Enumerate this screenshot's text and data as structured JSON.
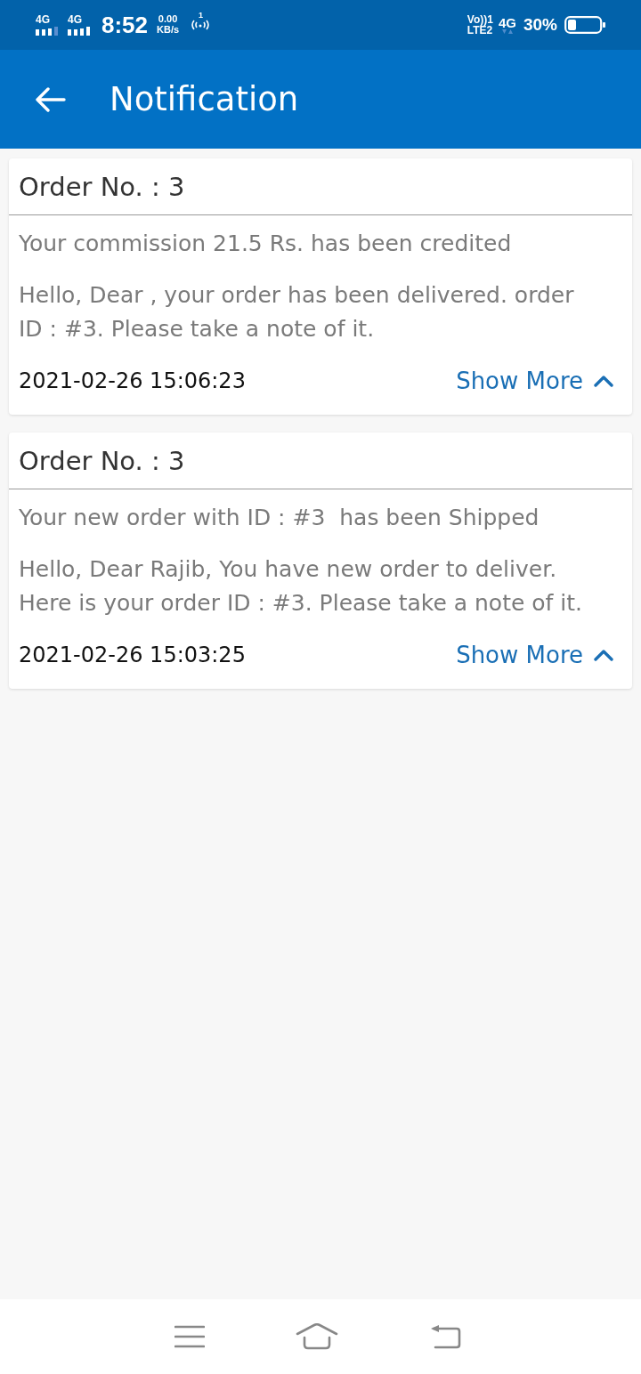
{
  "status_bar": {
    "sim1_network": "4G",
    "sim2_network": "4G",
    "time": "8:52",
    "speed_value": "0.00",
    "speed_unit": "KB/s",
    "hotspot_count": "1",
    "volte": "Vo))1",
    "volte_line": "LTE2",
    "data_network": "4G",
    "battery": "30%"
  },
  "app_bar": {
    "title": "Notification"
  },
  "notifications": [
    {
      "title": "Order No. : 3",
      "subtitle": "Your commission 21.5 Rs. has been credited",
      "message": "Hello, Dear , your order has been delivered. order ID : #3. Please take a note of it.",
      "time": "2021-02-26 15:06:23",
      "action": "Show More",
      "expanded": true
    },
    {
      "title": "Order No. : 3",
      "subtitle": "Your new order with ID : #3  has been Shipped",
      "message": "Hello, Dear Rajib, You have new order to deliver. Here is your order ID : #3. Please take a note of it.",
      "time": "2021-02-26 15:03:25",
      "action": "Show More",
      "expanded": true
    }
  ]
}
